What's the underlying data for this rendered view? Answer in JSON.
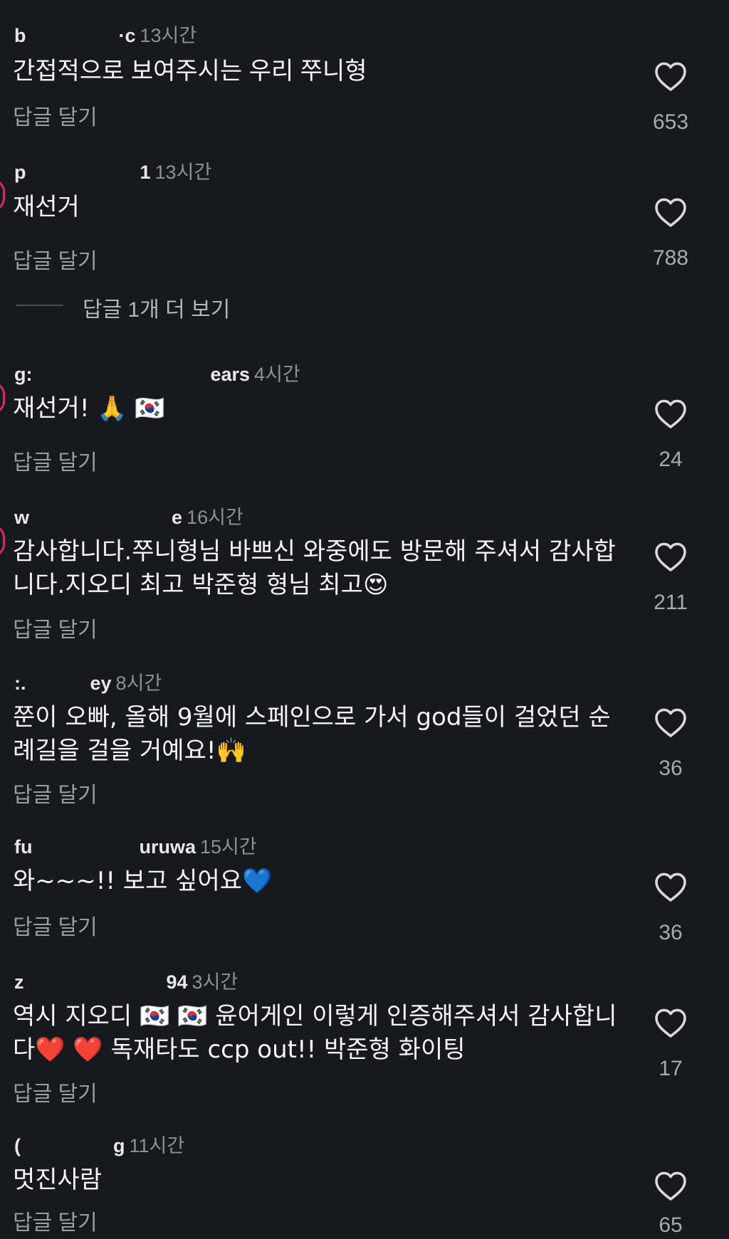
{
  "colors": {
    "background": "#161a1f",
    "text": "#f4f4f4",
    "muted": "#8e9196",
    "story_ring": "#e0295e"
  },
  "reply_label": "답글 달기",
  "view_more_replies": "답글 1개 더 보기",
  "comments": [
    {
      "user": "b",
      "user_tail": "·c",
      "time": "13시간",
      "text": "간접적으로 보여주시는 우리 쭈니형",
      "likes": "653",
      "story": false
    },
    {
      "user": "p",
      "user_tail": "1",
      "time": "13시간",
      "text": "재선거",
      "likes": "788",
      "story": true
    },
    {
      "user": "g:",
      "user_tail": "ears",
      "time": "4시간",
      "text": "재선거! 🙏 🇰🇷",
      "likes": "24",
      "story": true
    },
    {
      "user": "w",
      "user_tail": "e",
      "time": "16시간",
      "text": "감사합니다.쭈니형님 바쁘신 와중에도 방문해 주셔서 감사합니다.지오디 최고 박준형 형님 최고😍",
      "likes": "211",
      "story": true
    },
    {
      "user": ":.",
      "user_tail": "ey",
      "time": "8시간",
      "text": "쭌이 오빠, 올해 9월에 스페인으로 가서 god들이 걸었던 순례길을 걸을 거예요!🙌",
      "likes": "36",
      "story": false
    },
    {
      "user": "fu",
      "user_tail": "uruwa",
      "time": "15시간",
      "text": "와~~~!! 보고 싶어요💙",
      "likes": "36",
      "story": false
    },
    {
      "user": "z",
      "user_tail": "94",
      "time": "3시간",
      "text": "역시 지오디 🇰🇷 🇰🇷 윤어게인 이렇게 인증해주셔서 감사합니다❤️ ❤️ 독재타도 ccp out!! 박준형 화이팅",
      "likes": "17",
      "story": false
    },
    {
      "user": "(",
      "user_tail": "g",
      "time": "11시간",
      "text": "멋진사람",
      "likes": "65",
      "story": false
    }
  ]
}
